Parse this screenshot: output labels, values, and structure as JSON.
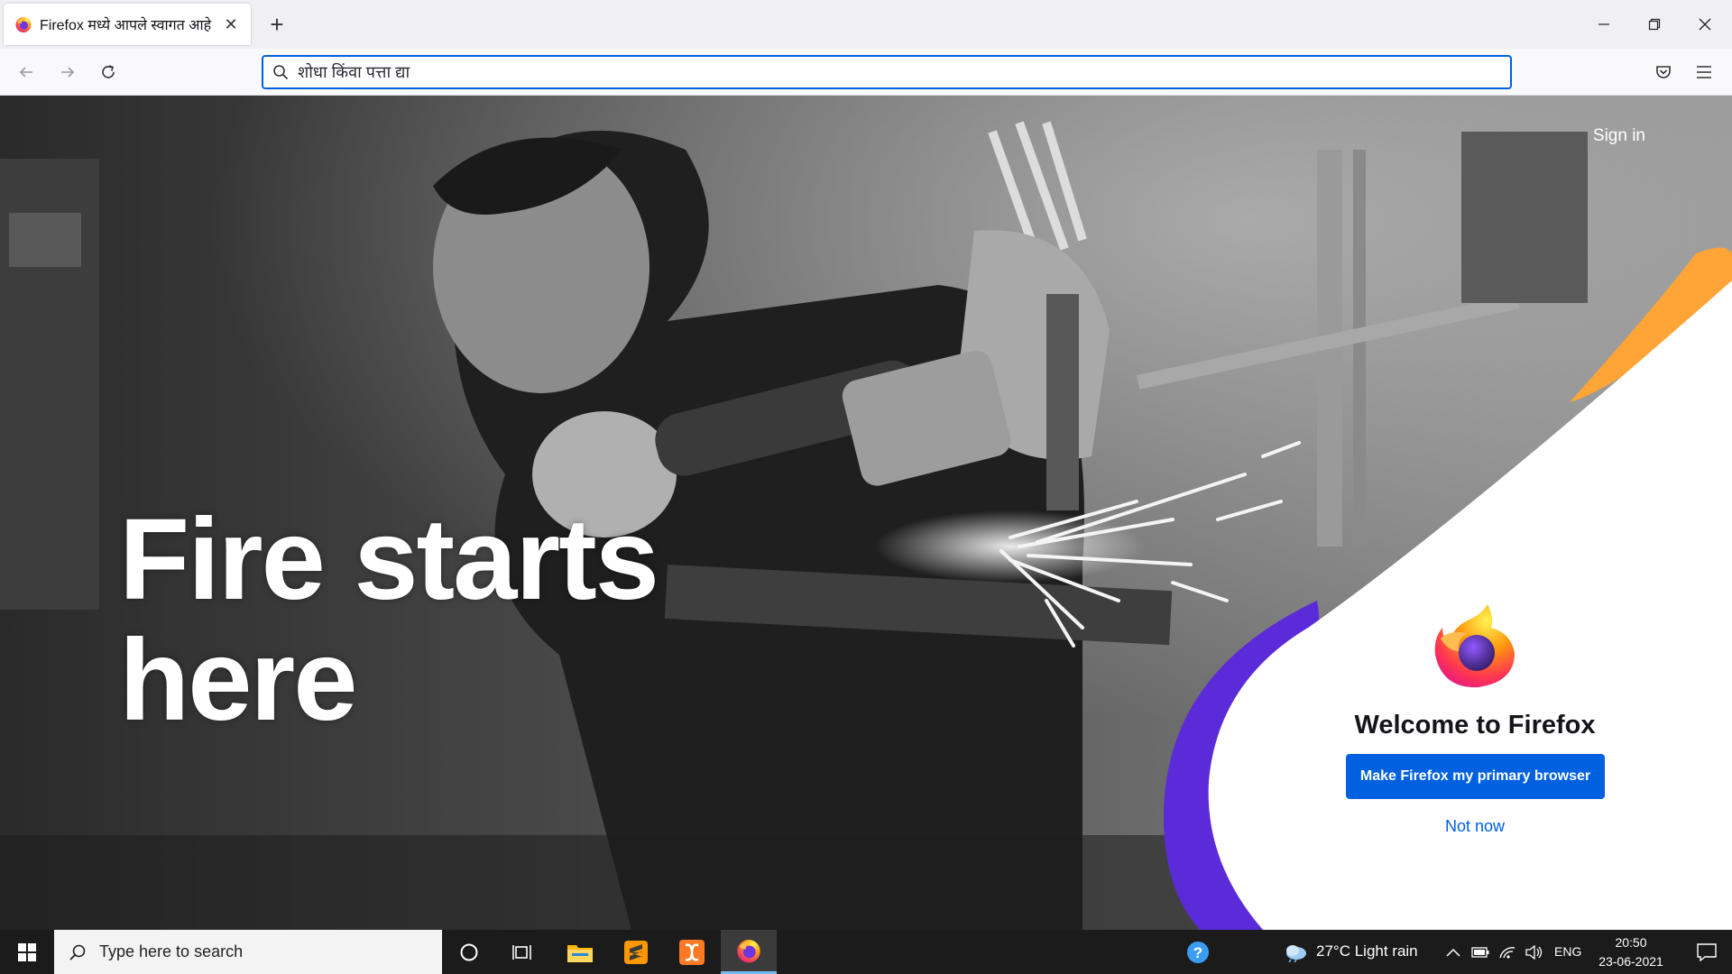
{
  "browser": {
    "tab": {
      "title": "Firefox मध्ये आपले स्वागत आहे",
      "close": "✕"
    },
    "new_tab": "+",
    "urlbar": {
      "placeholder": "शोधा किंवा पत्ता द्या",
      "value": ""
    }
  },
  "page": {
    "sign_in": "Sign in",
    "hero_line1": "Fire starts",
    "hero_line2": "here",
    "welcome_title": "Welcome to Firefox",
    "primary_button": "Make Firefox my primary browser",
    "secondary_link": "Not now"
  },
  "taskbar": {
    "search_placeholder": "Type here to search",
    "weather": "27°C  Light rain",
    "language": "ENG",
    "time": "20:50",
    "date": "23-06-2021"
  },
  "colors": {
    "accent_blue": "#0061e0",
    "purple": "#5b2bd9",
    "orange": "#ffa436"
  },
  "icons": [
    "firefox-icon",
    "close-icon",
    "plus-icon",
    "minimize-icon",
    "restore-icon",
    "back-icon",
    "forward-icon",
    "reload-icon",
    "search-icon",
    "pocket-icon",
    "menu-icon",
    "windows-icon",
    "cortana-icon",
    "task-view-icon",
    "file-explorer-icon",
    "sublime-text-icon",
    "xampp-icon",
    "help-icon",
    "weather-icon",
    "chevron-up-icon",
    "battery-icon",
    "wifi-icon",
    "volume-icon",
    "notification-icon"
  ]
}
